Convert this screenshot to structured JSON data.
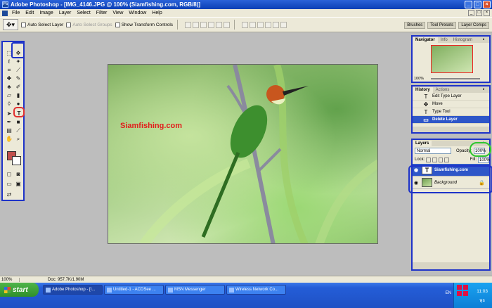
{
  "window": {
    "title": "Adobe Photoshop - [IMG_4146.JPG @ 100% (Siamfishing.com, RGB/8)]"
  },
  "menu": [
    "File",
    "Edit",
    "Image",
    "Layer",
    "Select",
    "Filter",
    "View",
    "Window",
    "Help"
  ],
  "options": {
    "auto_select_layer": "Auto Select Layer",
    "auto_select_groups": "Auto Select Groups",
    "show_transform_controls": "Show Transform Controls"
  },
  "palette_well": [
    "Brushes",
    "Tool Presets",
    "Layer Comps"
  ],
  "canvas": {
    "watermark": "Siamfishing.com"
  },
  "status": {
    "zoom": "100%",
    "doc": "Doc: 957.7K/1.90M"
  },
  "navigator": {
    "tabs": [
      "Navigator",
      "Info",
      "Histogram"
    ],
    "zoom": "100%"
  },
  "history": {
    "tabs": [
      "History",
      "Actions"
    ],
    "items": [
      {
        "label": "Edit Type Layer",
        "icon": "T"
      },
      {
        "label": "Move",
        "icon": "✥"
      },
      {
        "label": "Type Tool",
        "icon": "T"
      },
      {
        "label": "Delete Layer",
        "icon": "▭"
      }
    ]
  },
  "layers": {
    "title": "Layers",
    "blend_mode": "Normal",
    "opacity_label": "Opacity:",
    "opacity": "100%",
    "lock_label": "Lock:",
    "fill_label": "Fill:",
    "fill": "100%",
    "items": [
      {
        "name": "Siamfishing.com",
        "thumb": "T"
      },
      {
        "name": "Background"
      }
    ]
  },
  "taskbar": {
    "start": "start",
    "tasks": [
      "Adobe Photoshop - [I...",
      "Untitled-1 - ACDSee ...",
      "MSN Messenger",
      "Wireless Network Co..."
    ],
    "lang": "EN",
    "clock": "11:03",
    "day": "พุธ"
  }
}
